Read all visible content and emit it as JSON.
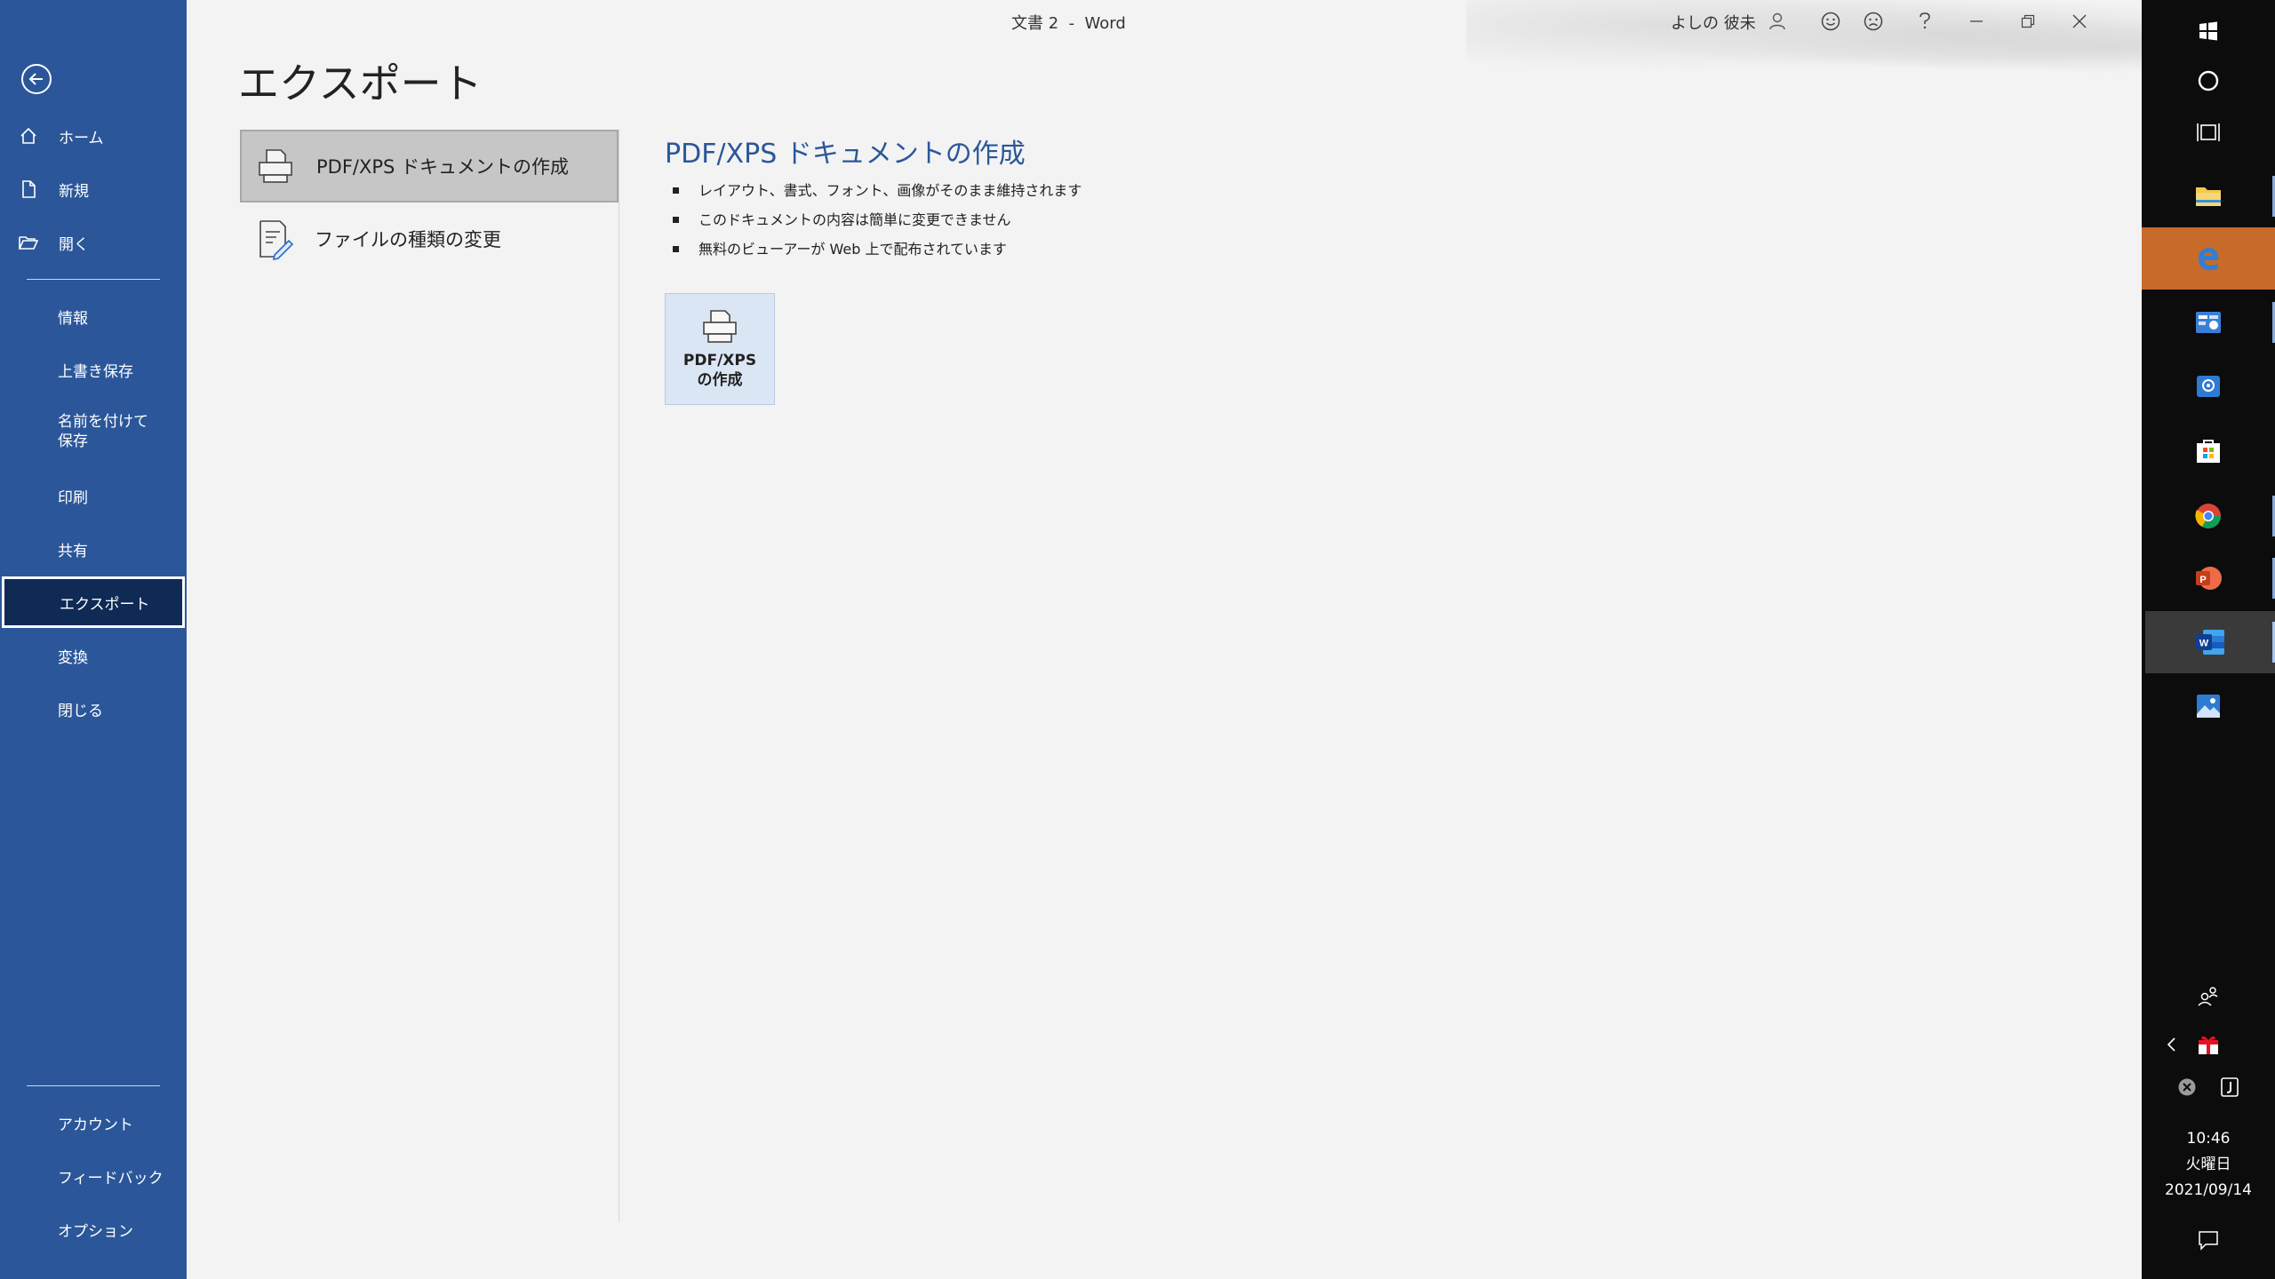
{
  "window": {
    "title": "文書 2  -  Word",
    "user": "よしの 彼未"
  },
  "nav": {
    "back": "戻る",
    "items": [
      {
        "label": "ホーム"
      },
      {
        "label": "新規"
      },
      {
        "label": "開く"
      },
      {
        "label": "情報"
      },
      {
        "label": "上書き保存"
      },
      {
        "label": "名前を付けて保存"
      },
      {
        "label": "印刷"
      },
      {
        "label": "共有"
      },
      {
        "label": "エクスポート"
      },
      {
        "label": "変換"
      },
      {
        "label": "閉じる"
      }
    ],
    "bottom": [
      {
        "label": "アカウント"
      },
      {
        "label": "フィードバック"
      },
      {
        "label": "オプション"
      }
    ],
    "active": "エクスポート"
  },
  "page": {
    "title": "エクスポート",
    "options": [
      {
        "label": "PDF/XPS ドキュメントの作成",
        "selected": true
      },
      {
        "label": "ファイルの種類の変更",
        "selected": false
      }
    ],
    "detail": {
      "heading": "PDF/XPS ドキュメントの作成",
      "bullets": [
        "レイアウト、書式、フォント、画像がそのまま維持されます",
        "このドキュメントの内容は簡単に変更できません",
        "無料のビューアーが Web 上で配布されています"
      ],
      "button_line1": "PDF/XPS",
      "button_line2": "の作成"
    }
  },
  "taskbar": {
    "apps": [
      "windows-start",
      "cortana",
      "task-view",
      "file-explorer",
      "edge",
      "control-panel",
      "mail",
      "store",
      "chrome",
      "powerpoint",
      "word",
      "photos"
    ],
    "clock": {
      "time": "10:46",
      "day": "火曜日",
      "date": "2021/09/14"
    }
  },
  "colors": {
    "nav_bg": "#2b579a",
    "nav_active_bg": "#0e2a55",
    "accent_heading": "#2b579a",
    "taskbar_bg": "#0c0c0c",
    "edge_highlight": "#c76a2a"
  }
}
